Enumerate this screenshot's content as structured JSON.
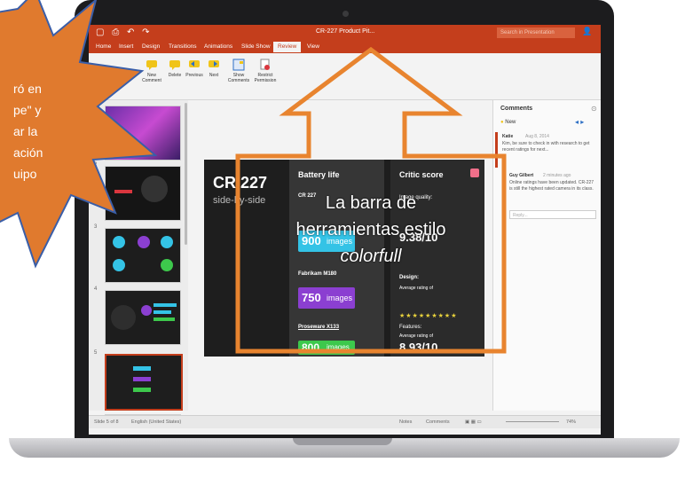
{
  "titlebar": {
    "title": "CR-227 Product Pit...",
    "search_placeholder": "Search in Presentation"
  },
  "tabs": [
    "Home",
    "Insert",
    "Design",
    "Transitions",
    "Animations",
    "Slide Show",
    "Review",
    "View"
  ],
  "active_tab": "Review",
  "ribbon": {
    "buttons": [
      "New Comment",
      "Delete",
      "Previous",
      "Next",
      "Show Comments",
      "Restrict Permission"
    ]
  },
  "slide": {
    "product_name": "CR 227",
    "tagline": "side-by-side",
    "battery_heading": "Battery life",
    "battery_items": [
      {
        "brand": "CR 227",
        "value": "900",
        "unit": "images"
      },
      {
        "brand": "Fabrikam M180",
        "value": "750",
        "unit": "images"
      },
      {
        "brand": "Proseware X133",
        "value": "800",
        "unit": "images"
      }
    ],
    "critic_heading": "Critic score",
    "critic_items": [
      {
        "label": "Image quality:",
        "sub": "Average rating of",
        "score": "9.38/10"
      },
      {
        "label": "Design:",
        "sub": "Average rating of",
        "score": "9.54/10"
      },
      {
        "label": "Features:",
        "sub": "Average rating of",
        "score": "8.93/10"
      }
    ],
    "stars": "★★★★★★★★★"
  },
  "comments": {
    "header": "Comments",
    "new_label": "New",
    "entries": [
      {
        "author": "Katie",
        "date": "Aug 8, 2014",
        "text": "Kim, be sure to check in with research to get recent ratings for next..."
      },
      {
        "author": "Guy Gilbert",
        "date": "2 minutes ago",
        "text": "Online ratings have been updated. CR-227 is still the highest rated camera in its class."
      }
    ],
    "reply_placeholder": "Reply..."
  },
  "status": {
    "slide_info": "Slide 5 of 8",
    "language": "English (United States)",
    "notes": "Notes",
    "comments": "Comments",
    "zoom": "74%"
  },
  "callout": {
    "lines": [
      "ró en",
      "pe\" y",
      "ar la",
      "ación",
      "uipo"
    ]
  },
  "overlay_label": {
    "line1": "La barra de",
    "line2": "herramientas estilo",
    "line3": "colorfull"
  },
  "colors": {
    "accent": "#c43e1c",
    "callout": "#e07a2e",
    "arrow": "#e8842f"
  }
}
